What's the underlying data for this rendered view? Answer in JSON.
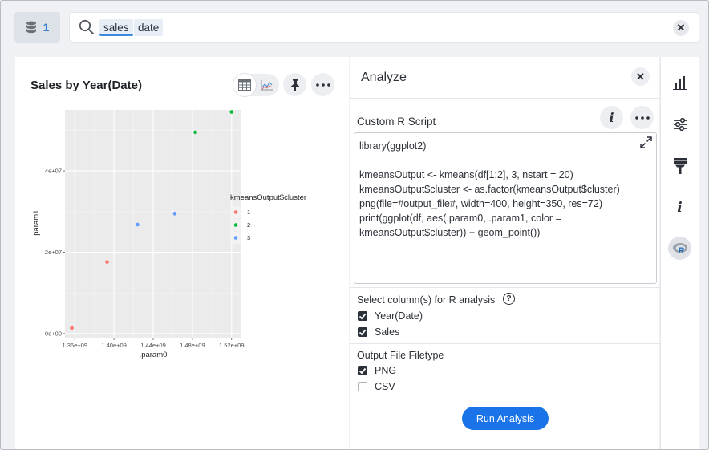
{
  "topbar": {
    "source_count": "1",
    "search_tokens": [
      "sales",
      "date"
    ]
  },
  "chart_panel": {
    "title": "Sales by Year(Date)"
  },
  "chart_data": {
    "type": "scatter",
    "title": "",
    "xlabel": ".param0",
    "ylabel": ".param1",
    "xlim": [
      1350000000.0,
      1530000000.0
    ],
    "ylim": [
      -1000000.0,
      55000000.0
    ],
    "x_ticks": [
      1360000000.0,
      1400000000.0,
      1440000000.0,
      1480000000.0,
      1520000000.0
    ],
    "x_tick_labels": [
      "1.36e+09",
      "1.40e+09",
      "1.44e+09",
      "1.48e+09",
      "1.52e+09"
    ],
    "y_ticks": [
      0,
      20000000.0,
      40000000.0
    ],
    "y_tick_labels": [
      "0e+00",
      "2e+07",
      "4e+07"
    ],
    "grid": true,
    "legend_title": "kmeansOutput$cluster",
    "legend_placement": "right",
    "series": [
      {
        "name": "1",
        "color": "#f8766d",
        "points": [
          [
            1357000000.0,
            1400000.0
          ],
          [
            1393000000.0,
            17600000.0
          ]
        ]
      },
      {
        "name": "2",
        "color": "#00ba38",
        "points": [
          [
            1483000000.0,
            49500000.0
          ],
          [
            1520000000.0,
            54500000.0
          ]
        ]
      },
      {
        "name": "3",
        "color": "#619cff",
        "points": [
          [
            1424000000.0,
            26800000.0
          ],
          [
            1462000000.0,
            29500000.0
          ]
        ]
      }
    ]
  },
  "analyze": {
    "title": "Analyze",
    "script_label": "Custom R Script",
    "script": "library(ggplot2)\n\nkmeansOutput <- kmeans(df[1:2], 3, nstart = 20)\nkmeansOutput$cluster <- as.factor(kmeansOutput$cluster)\npng(file=#output_file#, width=400, height=350, res=72)\nprint(ggplot(df, aes(.param0, .param1, color =\nkmeansOutput$cluster)) + geom_point())",
    "columns_title": "Select column(s) for R analysis",
    "columns": [
      {
        "label": "Year(Date)",
        "checked": true
      },
      {
        "label": "Sales",
        "checked": true
      }
    ],
    "filetype_title": "Output File Filetype",
    "filetypes": [
      {
        "label": "PNG",
        "checked": true
      },
      {
        "label": "CSV",
        "checked": false
      }
    ],
    "run_label": "Run Analysis"
  },
  "rail": {
    "icons": [
      "bar-chart-icon",
      "settings-sliders-icon",
      "paintbrush-icon",
      "info-icon",
      "r-icon"
    ]
  },
  "colors": {
    "accent": "#1a73e8",
    "panel_bg": "#eff1f4",
    "plot_bg": "#ebebeb"
  }
}
